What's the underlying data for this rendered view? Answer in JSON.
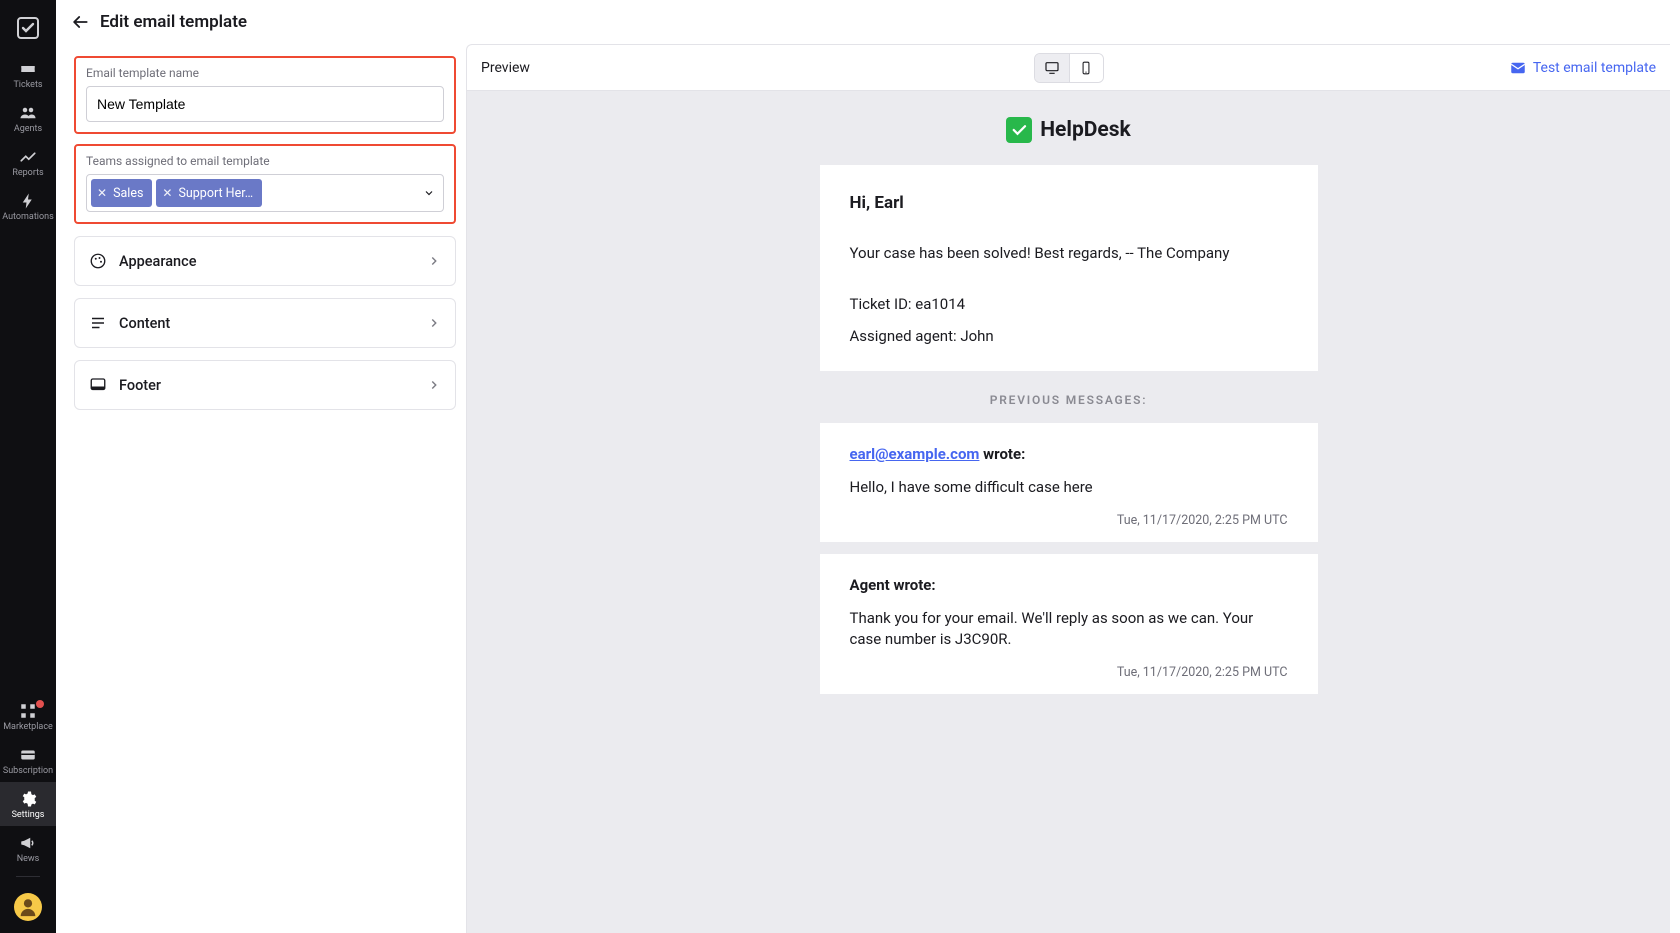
{
  "nav": {
    "items": [
      {
        "label": "Tickets"
      },
      {
        "label": "Agents"
      },
      {
        "label": "Reports"
      },
      {
        "label": "Automations"
      }
    ],
    "bottom": [
      {
        "label": "Marketplace",
        "badge": true
      },
      {
        "label": "Subscription"
      },
      {
        "label": "Settings",
        "active": true
      },
      {
        "label": "News"
      }
    ]
  },
  "header": {
    "title": "Edit email template"
  },
  "form": {
    "name_label": "Email template name",
    "name_value": "New Template",
    "teams_label": "Teams assigned to email template",
    "teams": [
      {
        "label": "Sales"
      },
      {
        "label": "Support Her…"
      }
    ]
  },
  "sections": [
    {
      "label": "Appearance"
    },
    {
      "label": "Content"
    },
    {
      "label": "Footer"
    }
  ],
  "preview": {
    "title": "Preview",
    "test_label": "Test email template",
    "brand": "HelpDesk",
    "greeting": "Hi, Earl",
    "body": "Your case has been solved! Best regards, -- The Company",
    "ticket_line": "Ticket ID: ea1014",
    "agent_line": "Assigned agent: John",
    "prev_label": "PREVIOUS MESSAGES:",
    "messages": [
      {
        "from_email": "earl@example.com",
        "from_suffix": " wrote:",
        "body": "Hello, I have some difficult case here",
        "ts": "Tue, 11/17/2020, 2:25 PM UTC"
      },
      {
        "from_plain": "Agent wrote:",
        "body": "Thank you for your email. We'll reply as soon as we can. Your case number is J3C90R.",
        "ts": "Tue, 11/17/2020, 2:25 PM UTC"
      }
    ]
  }
}
